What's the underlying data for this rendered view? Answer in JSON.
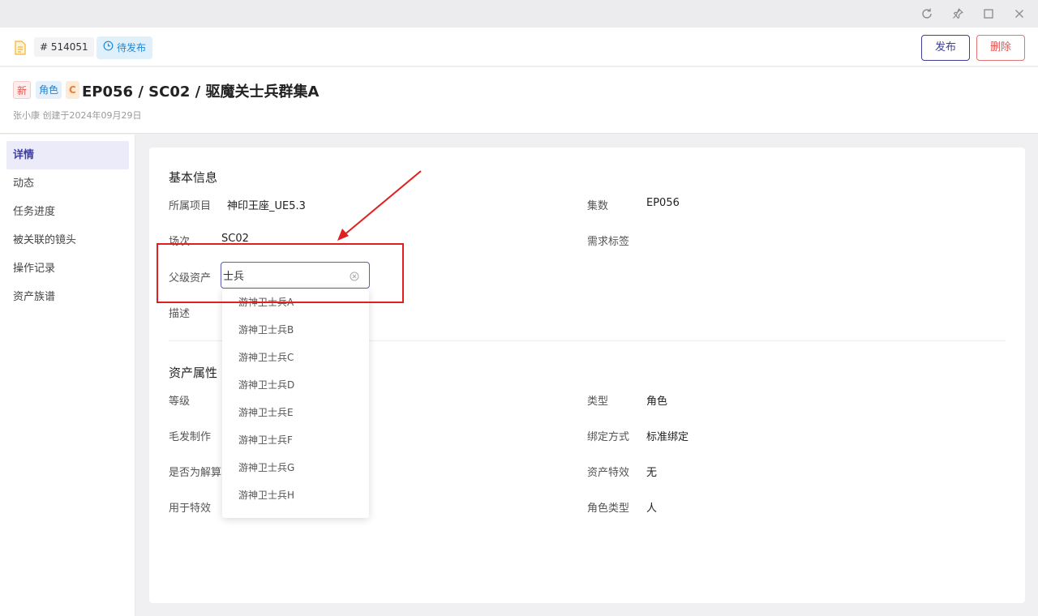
{
  "window": {
    "controls": [
      "refresh-icon",
      "pin-icon",
      "maximize-icon",
      "close-icon"
    ]
  },
  "topbar": {
    "id_label": "# 514051",
    "status_label": "待发布",
    "publish_label": "发布",
    "delete_label": "删除"
  },
  "header": {
    "tags": [
      "新",
      "角色",
      "C"
    ],
    "title": "EP056 / SC02 / 驱魔关士兵群集A",
    "creator": "张小康 创建于2024年09月29日"
  },
  "sidebar": {
    "items": [
      {
        "label": "详情",
        "active": true
      },
      {
        "label": "动态"
      },
      {
        "label": "任务进度"
      },
      {
        "label": "被关联的镜头"
      },
      {
        "label": "操作记录"
      },
      {
        "label": "资产族谱"
      }
    ]
  },
  "basic": {
    "title": "基本信息",
    "project_label": "所属项目",
    "project_value": "神印王座_UE5.3",
    "episode_label": "集数",
    "episode_value": "EP056",
    "scene_label": "场次",
    "scene_value": "SC02",
    "tags_label": "需求标签",
    "parent_label": "父级资产",
    "parent_value": "士兵",
    "desc_label": "描述"
  },
  "dropdown": {
    "options": [
      "游神卫士兵A",
      "游神卫士兵B",
      "游神卫士兵C",
      "游神卫士兵D",
      "游神卫士兵E",
      "游神卫士兵F",
      "游神卫士兵G",
      "游神卫士兵H"
    ]
  },
  "attrs": {
    "title": "资产属性",
    "level_label": "等级",
    "type_label": "类型",
    "type_value": "角色",
    "hair_label": "毛发制作",
    "bind_label": "绑定方式",
    "bind_value": "标准绑定",
    "solve_label": "是否为解算",
    "fx_label": "资产特效",
    "fx_value": "无",
    "usefx_label": "用于特效",
    "roletype_label": "角色类型",
    "roletype_value": "人"
  },
  "colors": {
    "accent": "#3f3f9a",
    "danger": "#e05555",
    "annotation": "#e02020"
  }
}
